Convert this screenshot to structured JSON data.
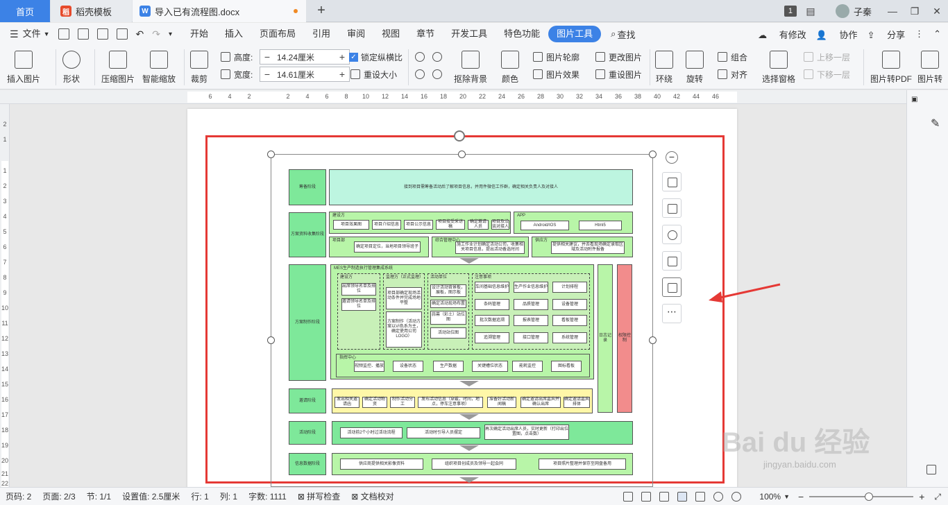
{
  "tabs": {
    "home": "首页",
    "daoke": "稻壳模板",
    "doc": "导入已有流程图.docx",
    "badge": "1",
    "user": "子秦"
  },
  "menu": {
    "file": "文件",
    "items": [
      "开始",
      "插入",
      "页面布局",
      "引用",
      "审阅",
      "视图",
      "章节",
      "开发工具",
      "特色功能"
    ],
    "active": "图片工具",
    "search": "查找",
    "right": [
      "有修改",
      "协作",
      "分享"
    ]
  },
  "ribbon": {
    "insert_picture": "插入图片",
    "shape": "形状",
    "compress": "压缩图片",
    "smart_zoom": "智能缩放",
    "crop": "裁剪",
    "height_label": "高度:",
    "height_value": "14.24厘米",
    "width_label": "宽度:",
    "width_value": "14.61厘米",
    "lock_ratio": "锁定纵横比",
    "reset_size": "重设大小",
    "remove_bg": "抠除背景",
    "color": "颜色",
    "outline": "图片轮廓",
    "effect": "图片效果",
    "change_pic": "更改图片",
    "reset_pic": "重设图片",
    "wrap": "环绕",
    "rotate": "旋转",
    "group": "组合",
    "align": "对齐",
    "select_pane": "选择窗格",
    "bring_forward": "上移一层",
    "send_backward": "下移一层",
    "to_pdf": "图片转PDF",
    "pic_more": "图片转"
  },
  "ruler_h": [
    "6",
    "4",
    "2",
    "2",
    "4",
    "6",
    "8",
    "10",
    "12",
    "14",
    "16",
    "18",
    "20",
    "22",
    "24",
    "26",
    "28",
    "30",
    "32",
    "34",
    "36",
    "38",
    "40",
    "42",
    "44",
    "46"
  ],
  "ruler_v": [
    "2",
    "1",
    "1",
    "2",
    "3",
    "4",
    "5",
    "6",
    "7",
    "8",
    "9",
    "10",
    "11",
    "12",
    "13",
    "14",
    "15",
    "16",
    "17",
    "18",
    "19",
    "20",
    "21",
    "22"
  ],
  "diagram": {
    "s1": "筹备阶段",
    "s1_text": "接到项目需筹备活动后了解项目信息，并用件微信工作群，确定相关负责人及对接人",
    "s2": "方案资料收集阶段",
    "jsf": "建设方",
    "jsf_items": [
      "项目效果图",
      "项目介绍信息",
      "项目公示信息",
      "项目接受采访稿",
      "确定邀请人员",
      "项目及洽谈对接人"
    ],
    "app": "APP",
    "app_items": [
      "Android/IOS",
      "Html5"
    ],
    "xmb": "项目部",
    "xmb_text": "确定项目定位，当地项目领导班子",
    "zhgl": "综合管理中心",
    "zhgl_text": "施工作业计划确定活动公司，收集相关项目信息，提出活动备选时间",
    "gys": "供应方",
    "gys_text": "提供相关建议，并去看现场确定录取区域及活动附件报备",
    "s3": "方案制作阶段",
    "mes": "MES生产制造执行管理集成系统",
    "col1": "建设方",
    "col1_items": [
      "出席领导名单及排位",
      "邀请领导名单及排位"
    ],
    "col2": "监理方（正式监理）",
    "col2_items": [
      "项目部确定现场活动条件并完成场地平整",
      "方案制作（活动方案以VI色系为主，确定使用公司LOGO）"
    ],
    "col3": "活动单位",
    "col3_items": [
      "设计活动背景板，展板，图示板",
      "确定活动现场布置",
      "蒜幕（彩土）站位图",
      "活动站位图"
    ],
    "col4": "注意事项",
    "col4_items": [
      "车间基础信息维护",
      "生产作业信息维护",
      "计划排程",
      "条码管理",
      "品质管理",
      "设备管理",
      "批次数据追溯",
      "报表管理",
      "看板管理",
      "追溯管理",
      "接口管理",
      "系统管理"
    ],
    "zk": "指挥中心",
    "zk_items": [
      "视频监控、播放",
      "设备状态",
      "生产数据",
      "关键槽位状态",
      "能耗监控",
      "图标看板"
    ],
    "log": "日志记录",
    "perm": "权限控制",
    "s4": "邀请阶段",
    "s4_items": [
      "发出相关邀请函",
      "确定活动物资",
      "制作活动分工",
      "发布活动信息（穿戴，时间，地点，停车注意事项）",
      "准备好活动新闻稿",
      "确定邀请出席嘉宾并确认出席",
      "确定邀请嘉宾排体"
    ],
    "s5": "活动阶段",
    "s5_items": [
      "活动前2个小时过活动流程",
      "活动时引导人员摆定",
      "再次确定活动出席人员，实时更新（打印出位置图，点击数）"
    ],
    "s6": "信息数据阶段",
    "s6_items": [
      "供应商提供相关影像资料",
      "组织项目创成员及领导一起会同",
      "项目照片整理并保存至网盘备用"
    ]
  },
  "status": {
    "page": "页码: 2",
    "pages": "页面: 2/3",
    "section": "节: 1/1",
    "setting": "设置值: 2.5厘米",
    "row": "行: 1",
    "col": "列: 1",
    "words": "字数: 1111",
    "spell": "拼写检查",
    "proof": "文档校对",
    "zoom": "100%"
  },
  "watermark": {
    "brand": "Bai du 经验",
    "url": "jingyan.baidu.com"
  }
}
